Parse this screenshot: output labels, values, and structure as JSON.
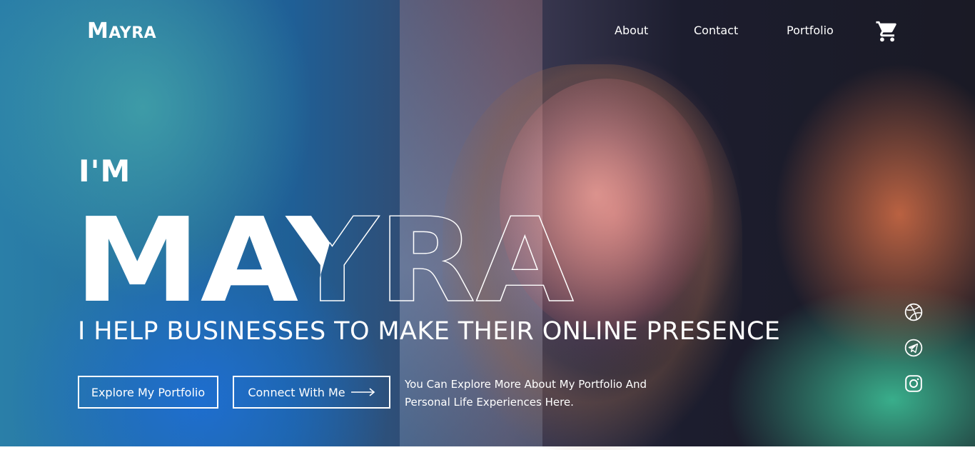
{
  "brand": {
    "first_letter": "M",
    "rest": "AYRA"
  },
  "nav": {
    "items": [
      "About",
      "Contact",
      "Portfolio"
    ]
  },
  "hero": {
    "prefix": "I'M",
    "name": "MAYRA",
    "tagline": "I HELP BUSINESSES TO MAKE THEIR ONLINE PRESENCE",
    "primary_button": "Explore My Portfolio",
    "secondary_button": "Connect With Me",
    "description": "You Can Explore More About My Portfolio And Personal Life Experiences Here."
  },
  "icons": {
    "cart": "shopping-cart-icon",
    "social": [
      "dribbble-icon",
      "telegram-icon",
      "instagram-icon"
    ]
  }
}
